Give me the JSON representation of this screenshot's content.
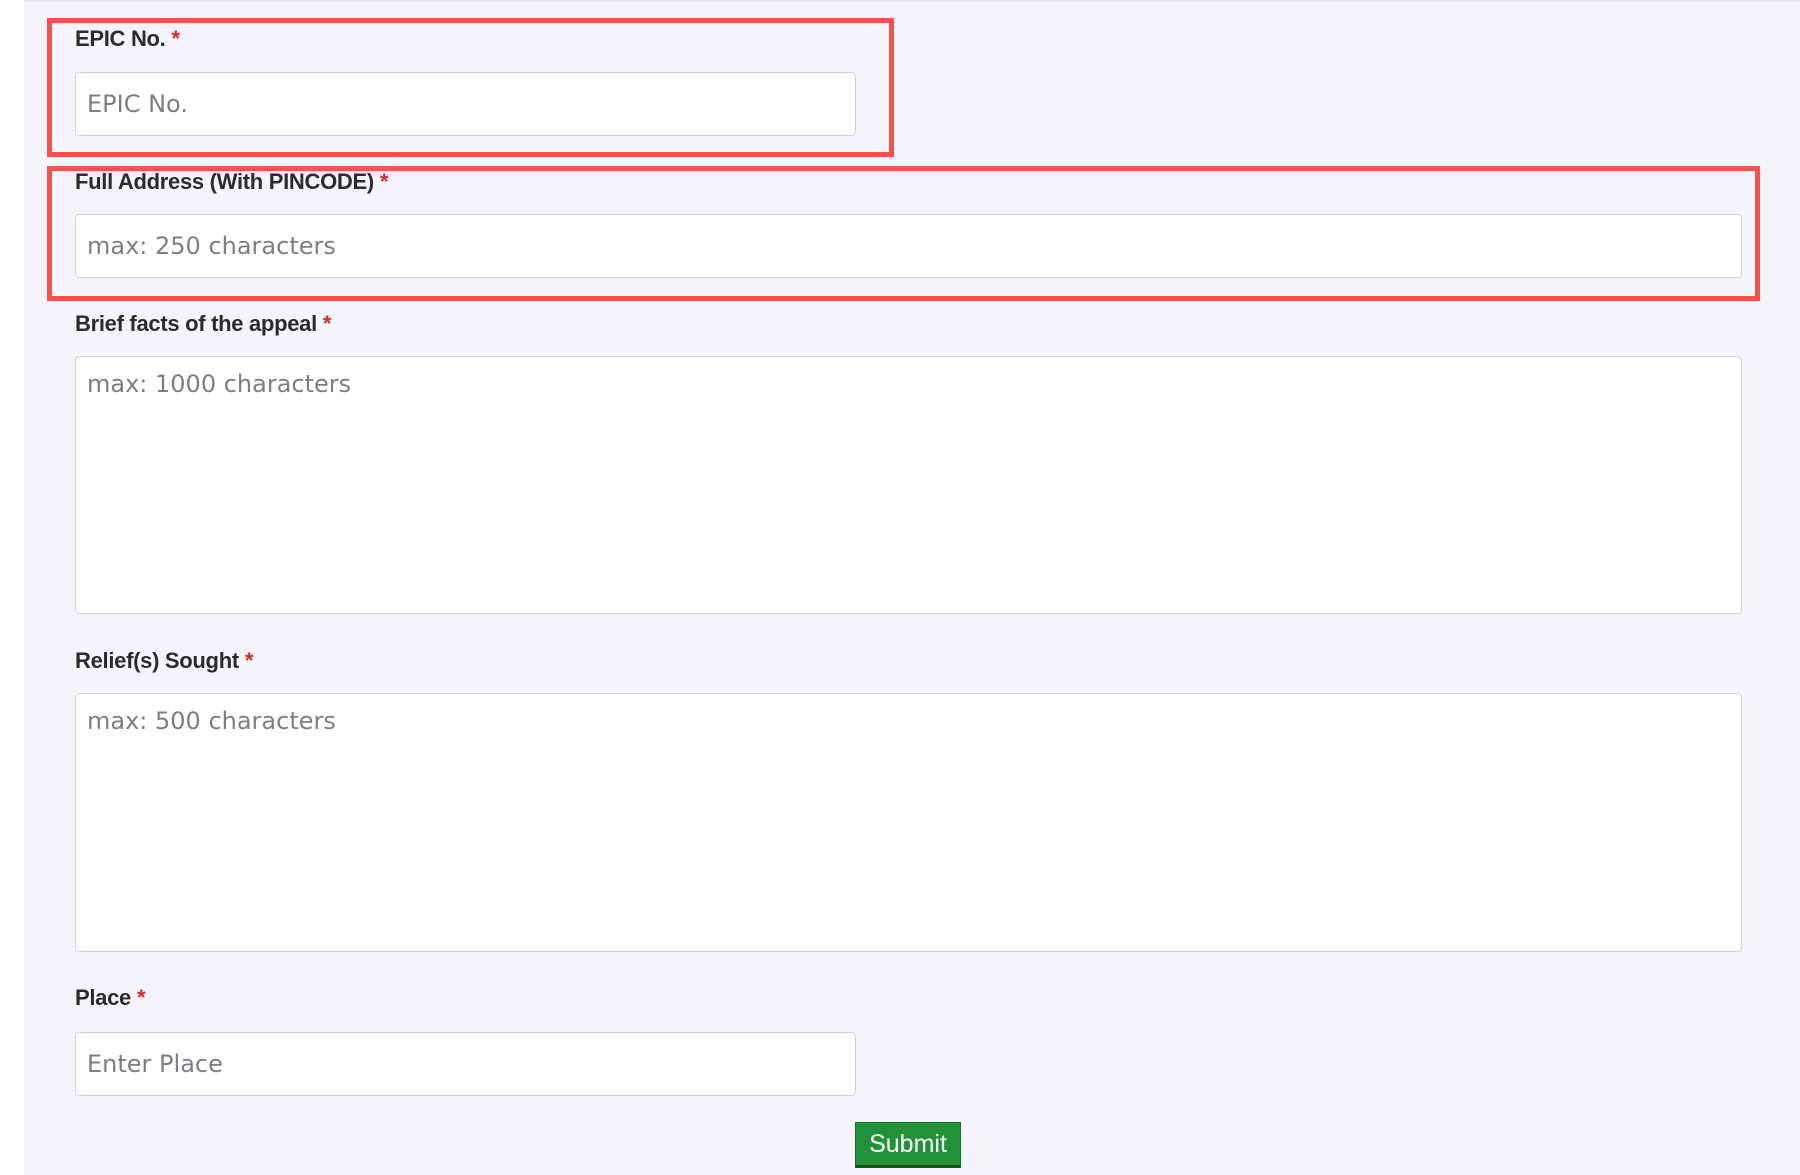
{
  "required_mark": "*",
  "form": {
    "epic": {
      "label": "EPIC No.",
      "placeholder": "EPIC No."
    },
    "address": {
      "label": "Full Address (With PINCODE)",
      "placeholder": "max: 250 characters"
    },
    "facts": {
      "label": "Brief facts of the appeal",
      "placeholder": "max: 1000 characters"
    },
    "relief": {
      "label": "Relief(s) Sought",
      "placeholder": "max: 500 characters"
    },
    "place": {
      "label": "Place",
      "placeholder": "Enter Place"
    },
    "submit_label": "Submit"
  },
  "colors": {
    "highlight": "#f0544a",
    "required": "#d8262a",
    "submit": "#21923a",
    "panel": "#f5f4fd"
  }
}
